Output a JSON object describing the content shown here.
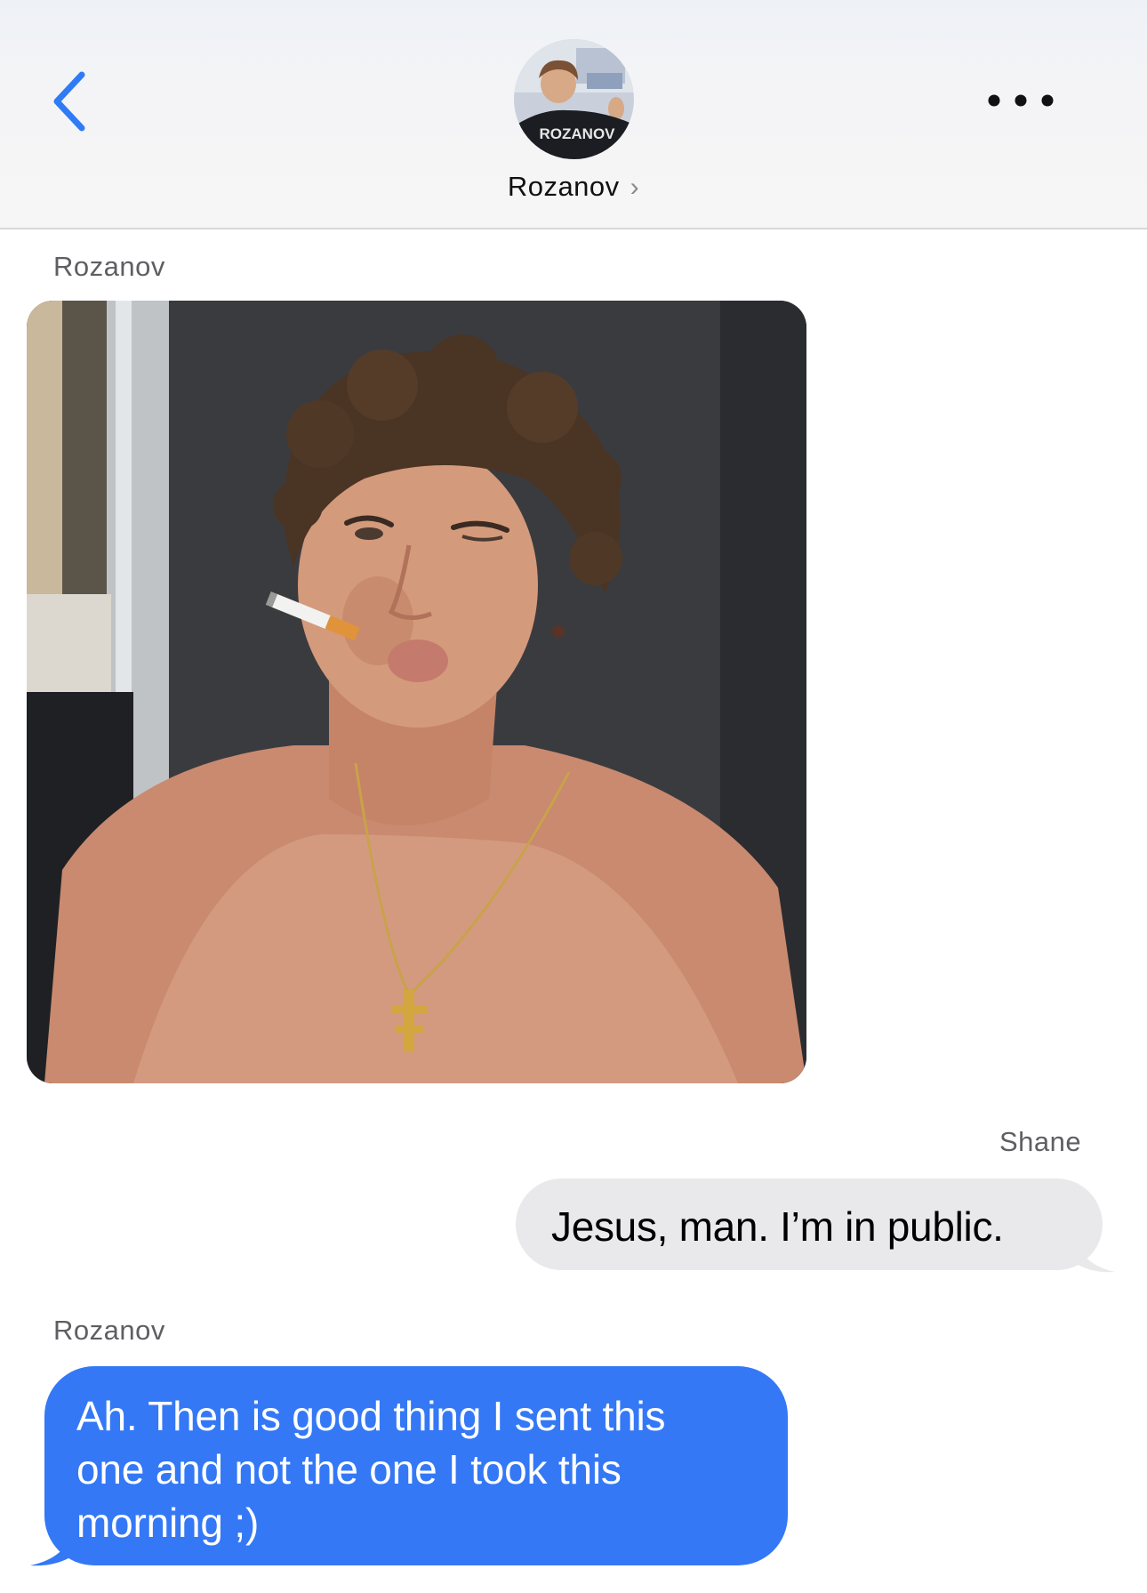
{
  "header": {
    "contact_name": "Rozanov",
    "chevron": "›",
    "back_icon": "chevron-left-icon",
    "more_icon": "ellipsis-icon",
    "avatar_jersey_text": "ROZANOV",
    "accent_color": "#3478f6"
  },
  "messages": [
    {
      "sender": "Rozanov",
      "type": "image",
      "description_icon": "photo"
    },
    {
      "sender": "Shane",
      "type": "text",
      "text": "Jesus, man. I’m in public.",
      "bubble_color": "#e9e9eb"
    },
    {
      "sender": "Rozanov",
      "type": "text",
      "lines": [
        "Ah. Then is good thing I sent this",
        "one and not the one I took this",
        "morning ;)"
      ],
      "bubble_color": "#3478f6"
    }
  ]
}
